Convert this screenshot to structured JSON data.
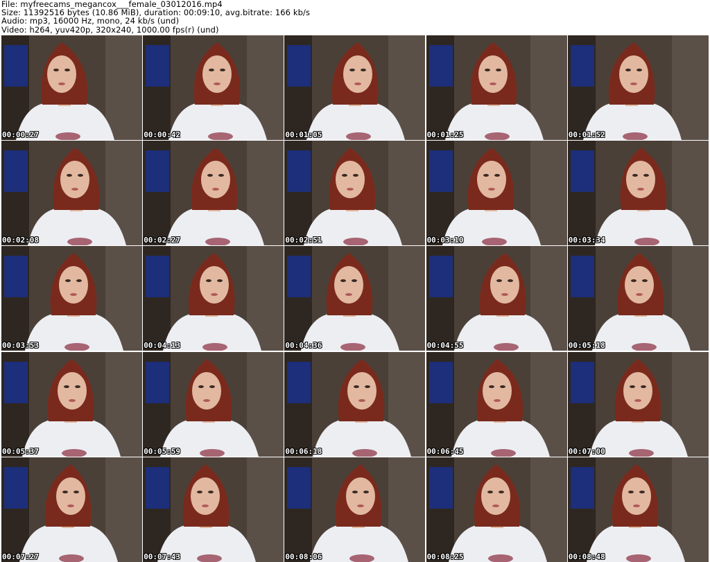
{
  "header": {
    "file": "File: myfreecams_megancox___female_03012016.mp4",
    "size": "Size: 11392516 bytes (10.86 MiB), duration: 00:09:10, avg.bitrate: 166 kb/s",
    "audio": "Audio: mp3, 16000 Hz, mono, 24 kb/s (und)",
    "video": "Video: h264, yuv420p, 320x240, 1000.00 fps(r) (und)"
  },
  "thumbnails": [
    {
      "timestamp": "00:00:27"
    },
    {
      "timestamp": "00:00:42"
    },
    {
      "timestamp": "00:01:05"
    },
    {
      "timestamp": "00:01:25"
    },
    {
      "timestamp": "00:01:52"
    },
    {
      "timestamp": "00:02:08"
    },
    {
      "timestamp": "00:02:27"
    },
    {
      "timestamp": "00:02:51"
    },
    {
      "timestamp": "00:03:10"
    },
    {
      "timestamp": "00:03:34"
    },
    {
      "timestamp": "00:03:53"
    },
    {
      "timestamp": "00:04:13"
    },
    {
      "timestamp": "00:04:36"
    },
    {
      "timestamp": "00:04:55"
    },
    {
      "timestamp": "00:05:18"
    },
    {
      "timestamp": "00:05:37"
    },
    {
      "timestamp": "00:05:59"
    },
    {
      "timestamp": "00:06:18"
    },
    {
      "timestamp": "00:06:45"
    },
    {
      "timestamp": "00:07:00"
    },
    {
      "timestamp": "00:07:27"
    },
    {
      "timestamp": "00:07:43"
    },
    {
      "timestamp": "00:08:06"
    },
    {
      "timestamp": "00:08:25"
    },
    {
      "timestamp": "00:08:48"
    }
  ],
  "colors": {
    "window_blue": "#1d2f7a",
    "wall": "#4a4038",
    "hair": "#7a2a1c",
    "skin": "#e2b8a0",
    "shirt": "#eceef2",
    "shirt_print": "#8a2a3c"
  }
}
